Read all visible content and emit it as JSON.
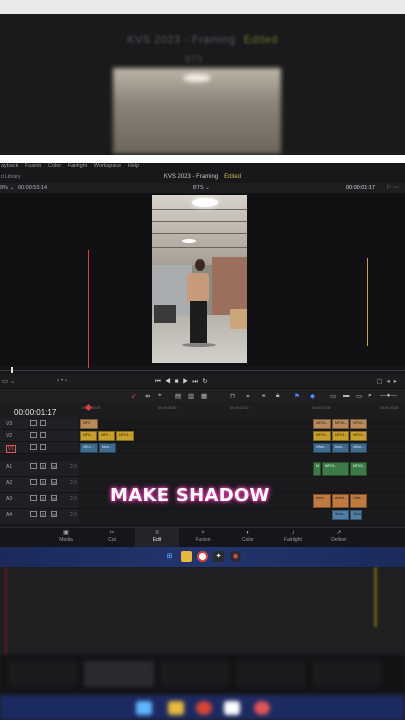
{
  "top_echo": {
    "title": "KVS 2023 - Framing",
    "edited": "Edited",
    "clip": "BTS"
  },
  "menubar": [
    "ayback",
    "Fusion",
    "Color",
    "Fairlight",
    "Workspace",
    "Help"
  ],
  "library_label": "d Library",
  "project": {
    "title": "KVS 2023 - Framing",
    "status": "Edited"
  },
  "viewer": {
    "zoom": "9%",
    "source_timecode": "00:00:53:14",
    "clip_name": "BTS",
    "record_timecode": "00:00:01:17"
  },
  "timeline": {
    "timecode": "00:00:01:17",
    "ruler_marks": [
      "00:00:00:00",
      "00:00:05:00",
      "00:00:10:00",
      "00:00:15:00",
      "00:00:20:00",
      "00:00:25:00"
    ],
    "tracks": [
      {
        "id": "V3",
        "vol": ""
      },
      {
        "id": "V2",
        "vol": ""
      },
      {
        "id": "V1",
        "vol": ""
      },
      {
        "id": "A1",
        "vol": "2.0"
      },
      {
        "id": "A2",
        "vol": "2.0"
      },
      {
        "id": "A3",
        "vol": "2.0"
      },
      {
        "id": "A4",
        "vol": "2.0"
      }
    ],
    "clips": {
      "v3_a": "MFX",
      "v3_b": "MFX0...",
      "v3_c": "MFX0...",
      "v3_d": "MFX0...",
      "v2_a": "MFX...",
      "v2_b": "MFX...",
      "v2_c": "MFX3...",
      "v2_d": "MFX3...",
      "v2_e": "MFX3...",
      "v2_f": "MFX3...",
      "v1_a": "offi e...",
      "v1_b": "bear...",
      "v1_c": "office...",
      "v1_d": "bear...",
      "v1_e": "office...",
      "a1_a": "M...",
      "a1_b": "MFX3...",
      "a1_c": "MFX3...",
      "a3_a": "Ume...",
      "a3_b": "Amba...",
      "a3_c": "Cate...",
      "a4_a": "Skea...",
      "a4_b": "Skea..."
    }
  },
  "overlay_caption": "MAKE SHADOW",
  "pages": [
    {
      "label": "Media",
      "icon": "▣",
      "active": false
    },
    {
      "label": "Cut",
      "icon": "✂",
      "active": false
    },
    {
      "label": "Edit",
      "icon": "≡",
      "active": true
    },
    {
      "label": "Fusion",
      "icon": "✧",
      "active": false
    },
    {
      "label": "Color",
      "icon": "◐",
      "active": false
    },
    {
      "label": "Fairlight",
      "icon": "♪",
      "active": false
    },
    {
      "label": "Deliver",
      "icon": "➚",
      "active": false
    }
  ],
  "colors": {
    "accent_edited": "#c9b84a",
    "playhead": "#e23b3b",
    "caption_glow": "#ff3dbb",
    "taskbar": "#22356e"
  }
}
